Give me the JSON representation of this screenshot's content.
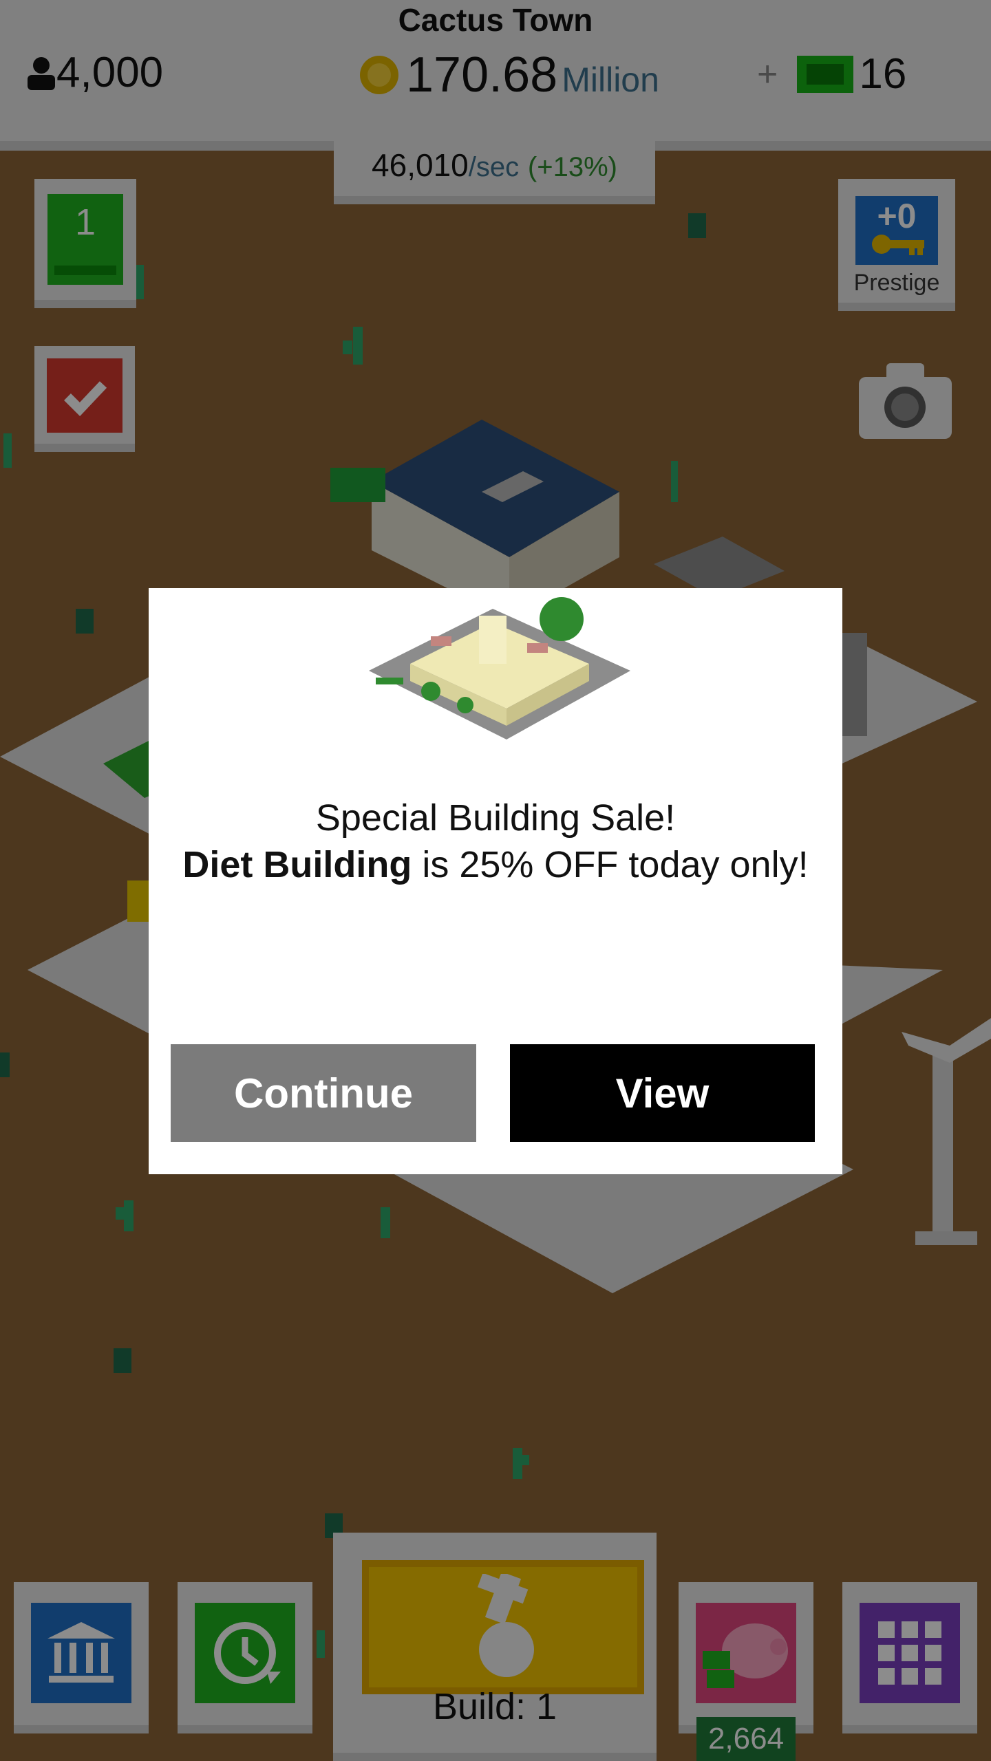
{
  "hud": {
    "city_name": "Cactus Town",
    "population": "4,000",
    "money_value": "170.68",
    "money_unit": "Million",
    "plus": "+",
    "cash_count": "16",
    "rate_value": "46,010",
    "rate_per": "/sec",
    "rate_bonus": "(+13%)"
  },
  "side": {
    "level": "1",
    "prestige_value": "+0",
    "prestige_label": "Prestige"
  },
  "modal": {
    "line1": "Special Building Sale!",
    "building_name": "Diet Building",
    "line2_rest": " is 25% OFF today only!",
    "continue_label": "Continue",
    "view_label": "View"
  },
  "bottom": {
    "build_label": "Build: 1",
    "piggy_count": "2,664"
  },
  "colors": {
    "accent_green": "#1fb31f",
    "accent_blue": "#1f6fc6",
    "accent_red": "#d63a2f",
    "accent_purple": "#7a3fbf",
    "accent_yellow": "#f2c400",
    "accent_pink": "#e0457f"
  },
  "icons": [
    "person-icon",
    "coin-icon",
    "cash-icon",
    "checkmark-icon",
    "key-icon",
    "camera-icon",
    "bank-icon",
    "clock-refresh-icon",
    "hammer-hand-icon",
    "piggy-bank-icon",
    "grid-icon"
  ]
}
